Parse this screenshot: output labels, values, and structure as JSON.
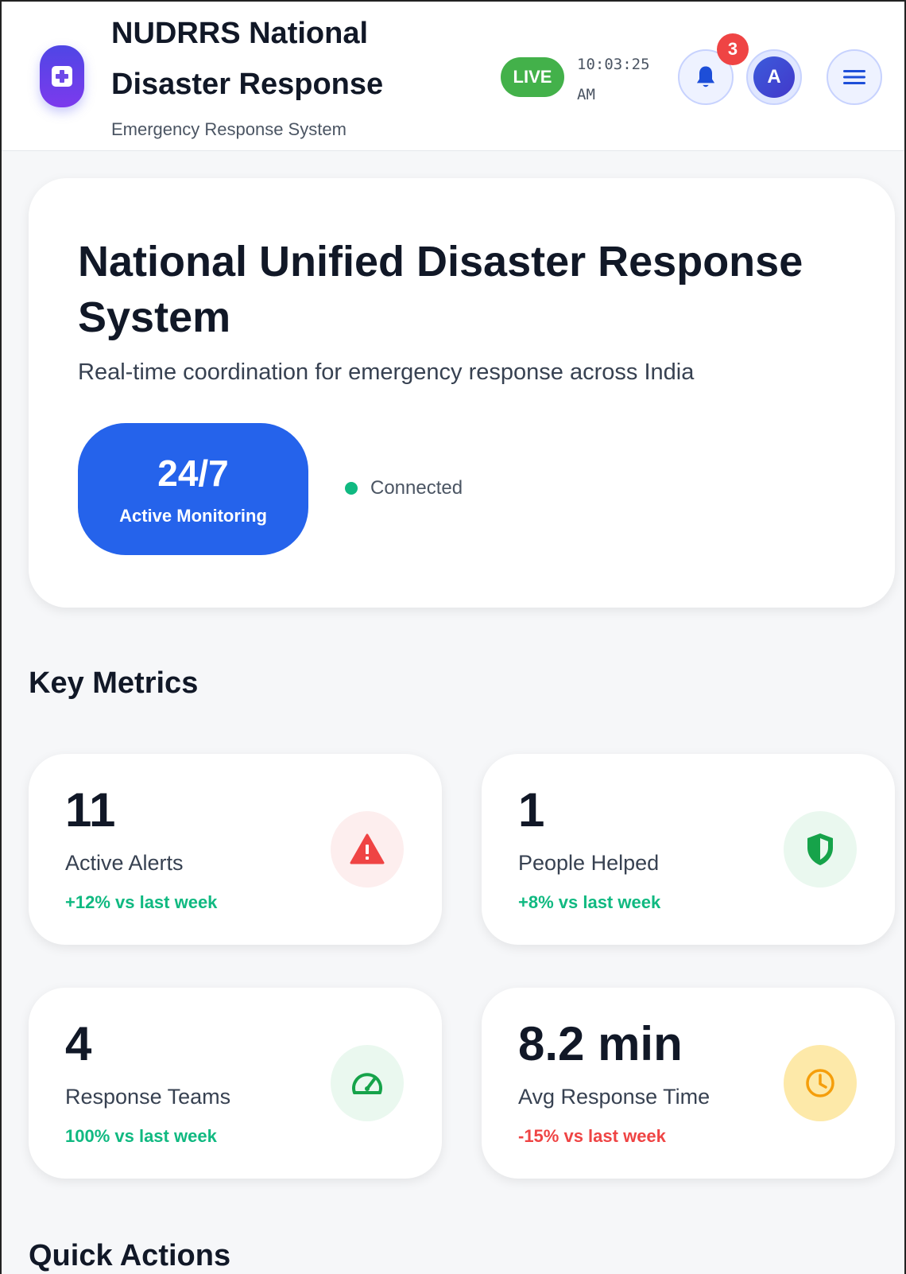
{
  "header": {
    "title": "NUDRRS National Disaster Response",
    "subtitle": "Emergency Response System",
    "live_label": "LIVE",
    "time": "10:03:25 AM",
    "notification_count": "3",
    "avatar_initial": "A"
  },
  "hero": {
    "title": "National Unified Disaster Response System",
    "subtitle": "Real-time coordination for emergency response across India",
    "monitor_value": "24/7",
    "monitor_label": "Active Monitoring",
    "connection_status": "Connected"
  },
  "metrics": {
    "section_title": "Key Metrics",
    "items": [
      {
        "value": "11",
        "label": "Active Alerts",
        "change": "+12% vs last week",
        "icon": "warning-icon",
        "change_color": "#10b981",
        "icon_bg": "#fdeeee",
        "icon_color": "#ef4444"
      },
      {
        "value": "1",
        "label": "People Helped",
        "change": "+8% vs last week",
        "icon": "shield-icon",
        "change_color": "#10b981",
        "icon_bg": "#eaf8ef",
        "icon_color": "#16a34a"
      },
      {
        "value": "4",
        "label": "Response Teams",
        "change": "100% vs last week",
        "icon": "speedometer-icon",
        "change_color": "#10b981",
        "icon_bg": "#eaf8ef",
        "icon_color": "#16a34a"
      },
      {
        "value": "8.2 min",
        "label": "Avg Response Time",
        "change": "-15% vs last week",
        "icon": "clock-icon",
        "change_color": "#ef4444",
        "icon_bg": "#fde9a9",
        "icon_color": "#f59e0b"
      }
    ]
  },
  "quick_actions": {
    "section_title": "Quick Actions"
  }
}
